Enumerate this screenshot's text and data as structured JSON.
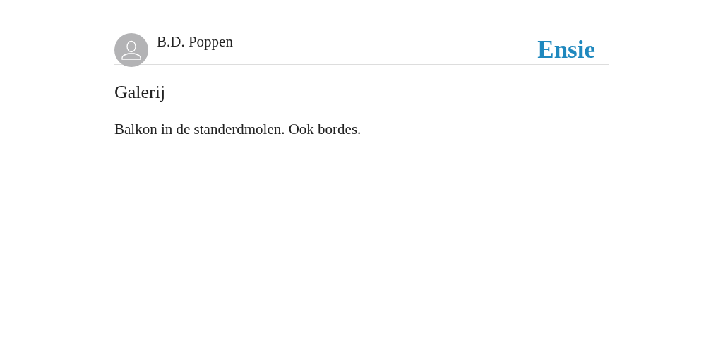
{
  "header": {
    "author": "B.D. Poppen",
    "logo": "Ensie"
  },
  "entry": {
    "title": "Galerij",
    "body": "Balkon in de standerdmolen. Ook bordes."
  }
}
